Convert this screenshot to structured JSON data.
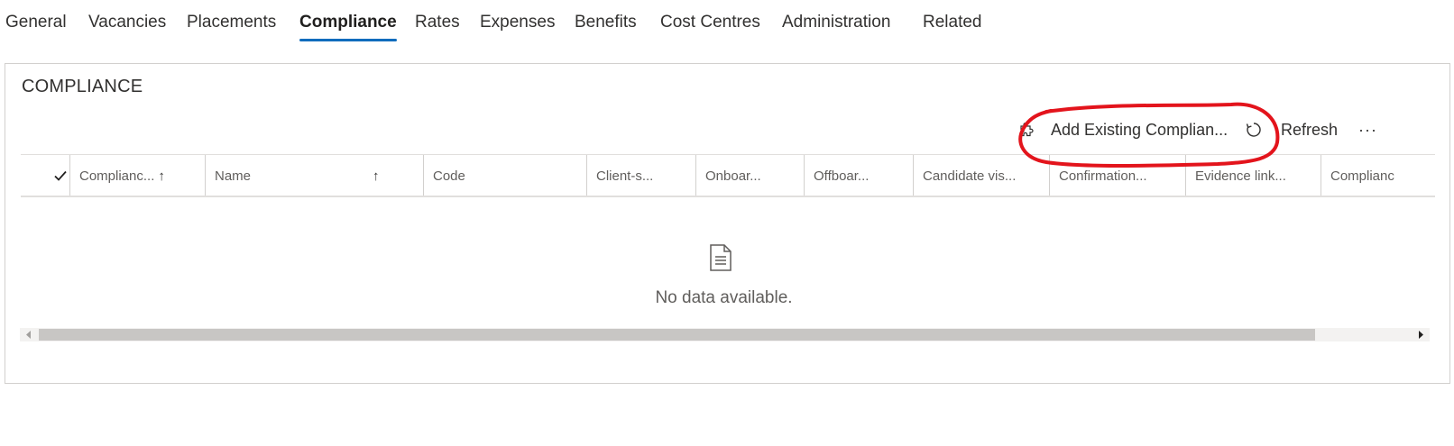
{
  "tabs": [
    {
      "label": "General",
      "active": false
    },
    {
      "label": "Vacancies",
      "active": false
    },
    {
      "label": "Placements",
      "active": false
    },
    {
      "label": "Compliance",
      "active": true
    },
    {
      "label": "Rates",
      "active": false
    },
    {
      "label": "Expenses",
      "active": false
    },
    {
      "label": "Benefits",
      "active": false
    },
    {
      "label": "Cost Centres",
      "active": false
    },
    {
      "label": "Administration",
      "active": false
    },
    {
      "label": "Related",
      "active": false
    }
  ],
  "section": {
    "title": "COMPLIANCE"
  },
  "commands": {
    "add_existing_label": "Add Existing Complian...",
    "add_existing_icon": "puzzle-icon",
    "refresh_label": "Refresh",
    "refresh_icon": "refresh-icon",
    "more_label": "···"
  },
  "grid": {
    "columns": [
      {
        "label": "Complianc...",
        "sort": "↑"
      },
      {
        "label": "Name",
        "sort": "↑"
      },
      {
        "label": "Code",
        "sort": ""
      },
      {
        "label": "Client-s...",
        "sort": ""
      },
      {
        "label": "Onboar...",
        "sort": ""
      },
      {
        "label": "Offboar...",
        "sort": ""
      },
      {
        "label": "Candidate vis...",
        "sort": ""
      },
      {
        "label": "Confirmation...",
        "sort": ""
      },
      {
        "label": "Evidence link...",
        "sort": ""
      },
      {
        "label": "Complianc",
        "sort": ""
      }
    ],
    "empty_message": "No data available.",
    "empty_icon": "document-icon"
  },
  "colors": {
    "accent": "#0f6cbd",
    "annotation": "#e3141c"
  }
}
